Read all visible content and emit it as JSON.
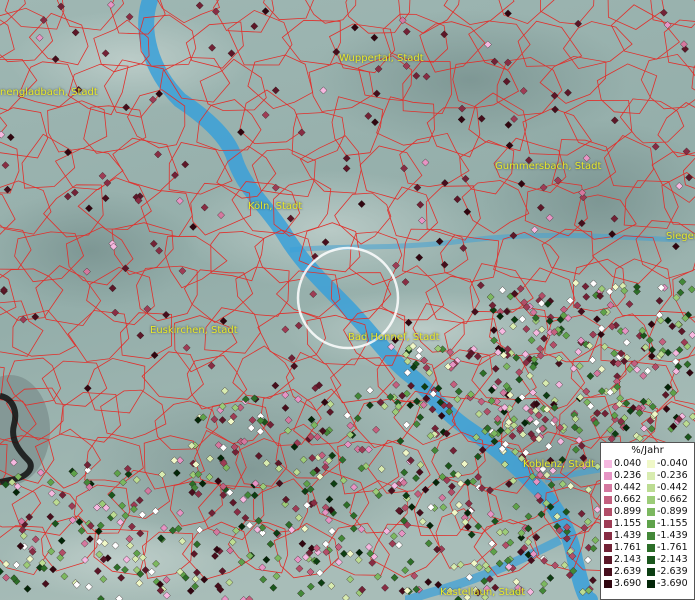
{
  "cities": [
    {
      "label": "Wuppertal, Stadt"
    },
    {
      "label": "nengladbach, Stadt"
    },
    {
      "label": "Gummersbach, Stadt"
    },
    {
      "label": "Köln, Stadt"
    },
    {
      "label": "Siegen"
    },
    {
      "label": "Euskirchen, Stadt"
    },
    {
      "label": "Bad Honnef, Stadt"
    },
    {
      "label": "Koblenz, Stadt"
    },
    {
      "label": "Kastellaun, Stadt"
    }
  ],
  "legend": {
    "title": "%/Jahr",
    "positive": [
      {
        "label": "0.040",
        "color": "#f5b8e0"
      },
      {
        "label": "0.236",
        "color": "#e694c4"
      },
      {
        "label": "0.442",
        "color": "#d4789f"
      },
      {
        "label": "0.662",
        "color": "#c4607f"
      },
      {
        "label": "0.899",
        "color": "#b24e68"
      },
      {
        "label": "1.155",
        "color": "#9e3c55"
      },
      {
        "label": "1.439",
        "color": "#882d44"
      },
      {
        "label": "1.761",
        "color": "#722236"
      },
      {
        "label": "2.143",
        "color": "#5c1728"
      },
      {
        "label": "2.639",
        "color": "#460e1c"
      },
      {
        "label": "3.690",
        "color": "#300610"
      }
    ],
    "negative": [
      {
        "label": "-0.040",
        "color": "#f0f8c8"
      },
      {
        "label": "-0.236",
        "color": "#d8ecb0"
      },
      {
        "label": "-0.442",
        "color": "#bcdc92"
      },
      {
        "label": "-0.662",
        "color": "#9ccc78"
      },
      {
        "label": "-0.899",
        "color": "#7cb860"
      },
      {
        "label": "-1.155",
        "color": "#5ea24a"
      },
      {
        "label": "-1.439",
        "color": "#438838"
      },
      {
        "label": "-1.761",
        "color": "#2c6e28"
      },
      {
        "label": "-2.143",
        "color": "#1a561c"
      },
      {
        "label": "-2.639",
        "color": "#0c3e12"
      },
      {
        "label": "-3.690",
        "color": "#032608"
      }
    ]
  },
  "colors": {
    "boundary": "#e0302c",
    "river": "#3aa0d8",
    "selection": "#ffffff",
    "label": "#e8ea2a"
  }
}
